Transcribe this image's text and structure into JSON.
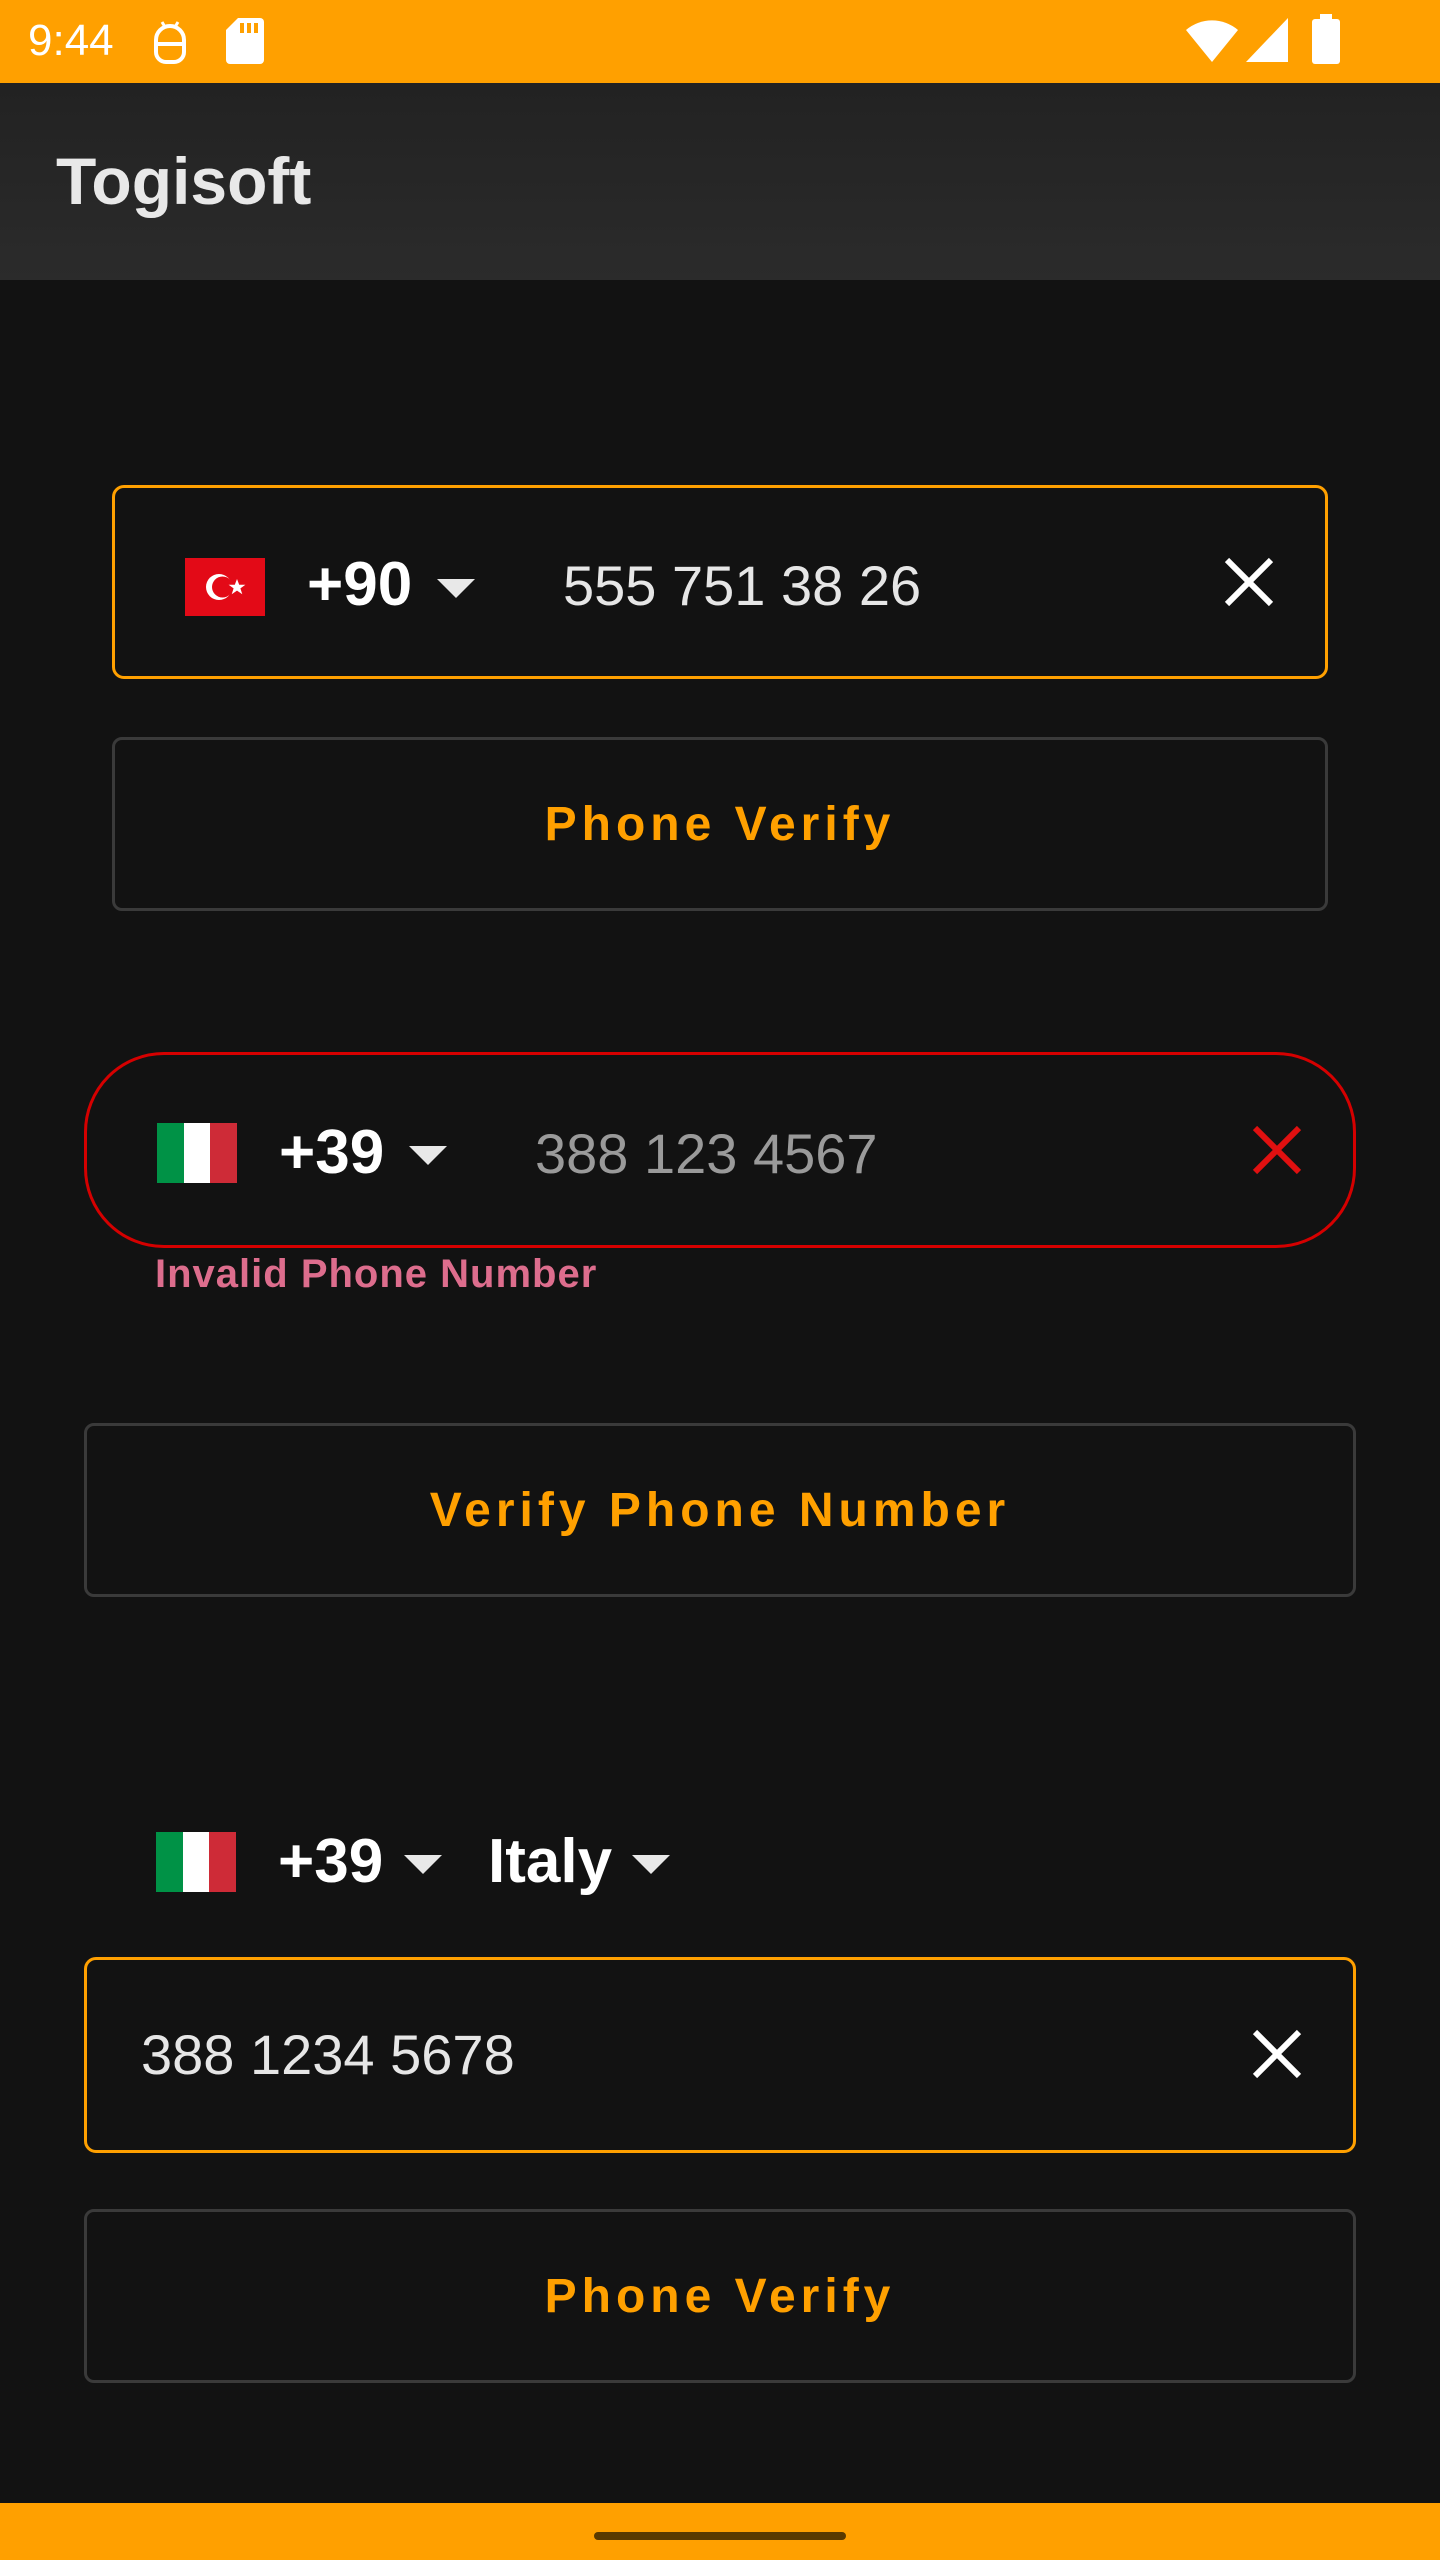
{
  "status_bar": {
    "time": "9:44",
    "icons": [
      "android-debug-icon",
      "sd-card-icon",
      "wifi-icon",
      "signal-icon",
      "battery-icon"
    ]
  },
  "app_bar": {
    "title": "Togisoft"
  },
  "form1": {
    "country_flag": "turkey-flag-icon",
    "dial_code": "+90",
    "phone_value": "555 751 38 26",
    "button_label": "Phone Verify"
  },
  "form2": {
    "country_flag": "italy-flag-icon",
    "dial_code": "+39",
    "phone_value": "388 123 4567",
    "error_message": "Invalid Phone Number",
    "button_label": "Verify Phone Number"
  },
  "form3": {
    "country_flag": "italy-flag-icon",
    "dial_code": "+39",
    "country_name": "Italy",
    "phone_value": "388 1234 5678",
    "button_label": "Phone Verify"
  },
  "colors": {
    "accent": "#FFA000",
    "error": "#D50000",
    "error_text": "#DD6D8D",
    "background": "#121212"
  }
}
